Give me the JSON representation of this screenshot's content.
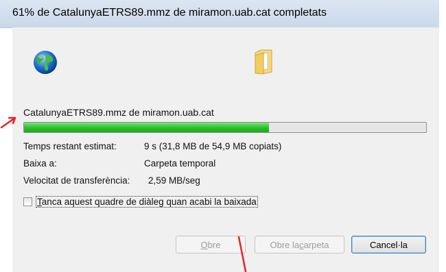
{
  "window": {
    "title": "61% de CatalunyaETRS89.mmz de miramon.uab.cat completats"
  },
  "download": {
    "file_label": "CatalunyaETRS89.mmz de miramon.uab.cat",
    "progress": 0.61,
    "progress_color": "#2fc12f",
    "rows": [
      {
        "label": "Temps restant estimat:",
        "value": "9 s (31,8 MB de 54,9 MB copiats)"
      },
      {
        "label": "Baixa a:",
        "value": "Carpeta temporal"
      },
      {
        "label": "Velocitat de transferència:",
        "value": "2,59 MB/seg"
      }
    ],
    "close_checkbox": {
      "checked": false,
      "label_underlined": "T",
      "label_rest": "anca aquest quadre de diàleg quan acabi la baixada"
    }
  },
  "buttons": {
    "open": {
      "label_underlined": "O",
      "label_rest": "bre",
      "enabled": false
    },
    "open_folder": {
      "label_pre": "Obre la ",
      "label_underlined": "c",
      "label_rest": "arpeta",
      "enabled": false
    },
    "cancel": {
      "label": "Cancel·la",
      "enabled": true
    }
  },
  "icons": {
    "source": "globe-icon",
    "destination": "folder-icon"
  },
  "annotation_color": "#e8212a"
}
